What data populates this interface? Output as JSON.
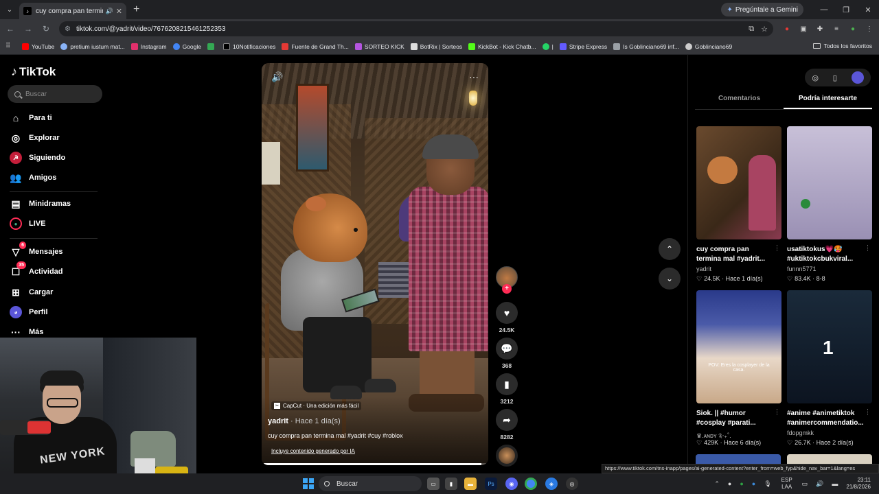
{
  "browser": {
    "tab_title": "cuy compra pan termina m",
    "gemini_label": "Pregúntale a Gemini",
    "url": "tiktok.com/@yadrit/video/7676208215461252353",
    "bookmarks": [
      {
        "label": "YouTube",
        "color": "#ff0000"
      },
      {
        "label": "pretium iustum mat...",
        "color": "#8ab4f8"
      },
      {
        "label": "Instagram",
        "color": "#e1306c"
      },
      {
        "label": "Google",
        "color": "#4285f4"
      },
      {
        "label": "",
        "color": "#34a853"
      },
      {
        "label": "10Notificaciones",
        "color": "#ffffff"
      },
      {
        "label": "Fuente de Grand Th...",
        "color": "#e53935"
      },
      {
        "label": "SORTEO KICK",
        "color": "#b455e0"
      },
      {
        "label": "BotRix | Sorteos",
        "color": "#dddddd"
      },
      {
        "label": "KickBot - Kick Chatb...",
        "color": "#53fc18"
      },
      {
        "label": "|",
        "color": "#25d366"
      },
      {
        "label": "Stripe Express",
        "color": "#635bff"
      },
      {
        "label": "Is Goblinciano69 inf...",
        "color": "#9aa0a6"
      },
      {
        "label": "Goblinciano69",
        "color": "#cccccc"
      }
    ],
    "all_bookmarks": "Todos los favoritos"
  },
  "sidebar": {
    "logo": "TikTok",
    "search_placeholder": "Buscar",
    "items": [
      {
        "label": "Para ti",
        "icon": "home-icon",
        "badge": ""
      },
      {
        "label": "Explorar",
        "icon": "compass-icon",
        "badge": ""
      },
      {
        "label": "Siguiendo",
        "icon": "following-icon",
        "badge": ""
      },
      {
        "label": "Amigos",
        "icon": "friends-icon",
        "badge": ""
      },
      {
        "label": "Minidramas",
        "icon": "film-icon",
        "badge": ""
      },
      {
        "label": "LIVE",
        "icon": "live-icon",
        "badge": ""
      },
      {
        "label": "Mensajes",
        "icon": "messages-icon",
        "badge": "6"
      },
      {
        "label": "Actividad",
        "icon": "activity-icon",
        "badge": "35"
      },
      {
        "label": "Cargar",
        "icon": "upload-icon",
        "badge": ""
      },
      {
        "label": "Perfil",
        "icon": "profile-icon",
        "badge": ""
      },
      {
        "label": "Más",
        "icon": "more-icon",
        "badge": ""
      }
    ]
  },
  "webcam": {
    "shirt_text": "NEW YORK"
  },
  "video": {
    "capcut_label": "CapCut · Una edición más fácil",
    "author": "yadrit",
    "posted": "· Hace 1 día(s)",
    "description": "cuy compra pan termina mal #yadrit #cuy #roblox",
    "ai_label": "Incluye contenido generado por IA",
    "progress": 0.97
  },
  "actions": {
    "likes": "24.5K",
    "comments": "368",
    "saves": "3212",
    "shares": "8282"
  },
  "panel": {
    "tab_comments": "Comentarios",
    "tab_suggested": "Podría interesarte",
    "cards": [
      {
        "title": "cuy compra pan termina mal #yadrit...",
        "author": "yadrit",
        "stats": "24.5K · Hace 1 día(s)",
        "overlay": ""
      },
      {
        "title": "usatiktokus💗🥵 #uktiktokcbukviral...",
        "author": "funnn5771",
        "stats": "83.4K · 8-8",
        "overlay": ""
      },
      {
        "title": "Siok. || #humor #cosplay #parati...",
        "author": "♛.ᴀɴᴅʏ ༉‧₊˚.",
        "stats": "429K · Hace 6 día(s)",
        "overlay": "POV: Eres la cosplayer de la casa."
      },
      {
        "title": "#anime #animetiktok #animercommendatio...",
        "author": "fdopgmkk",
        "stats": "26.7K · Hace 2 día(s)",
        "overlay": "1"
      }
    ]
  },
  "status_url": "https://www.tiktok.com/tns-inapp/pages/ai-generated-content?enter_from=web_fyp&hide_nav_bar=1&lang=es",
  "taskbar": {
    "search": "Buscar",
    "lang_top": "ESP",
    "lang_bottom": "LAA",
    "time": "23:11",
    "date": "21/8/2026"
  }
}
